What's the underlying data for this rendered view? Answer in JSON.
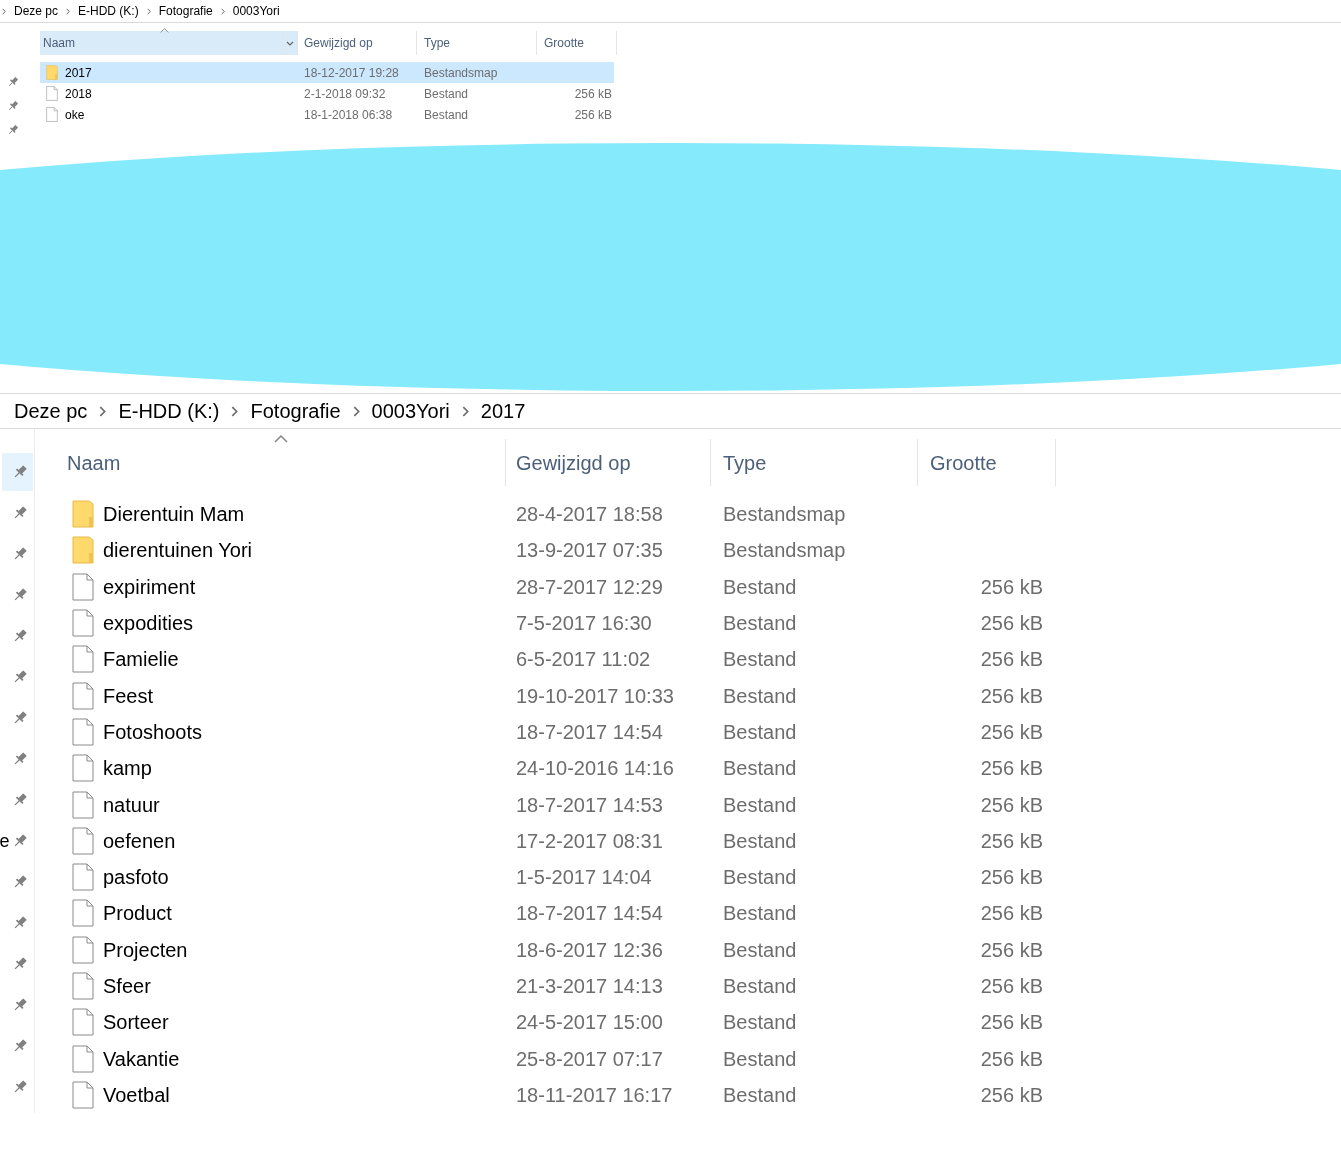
{
  "top_explorer": {
    "breadcrumb": [
      "Deze pc",
      "E-HDD (K:)",
      "Fotografie",
      "0003Yori"
    ],
    "pins": [
      {
        "highlighted": false
      },
      {
        "highlighted": false
      },
      {
        "highlighted": false
      }
    ],
    "columns": [
      "Naam",
      "Gewijzigd op",
      "Type",
      "Grootte"
    ],
    "rows": [
      {
        "kind": "folder",
        "name": "2017",
        "modified": "18-12-2017 19:28",
        "type": "Bestandsmap",
        "selected": true
      },
      {
        "kind": "file",
        "name": "2018",
        "modified": "2-1-2018 09:32",
        "type": "Bestand",
        "size": "256 kB",
        "selected": false
      },
      {
        "kind": "file",
        "name": "oke",
        "modified": "18-1-2018 06:38",
        "type": "Bestand",
        "size": "256 kB",
        "selected": false
      }
    ]
  },
  "bottom_explorer": {
    "breadcrumb": [
      "Deze pc",
      "E-HDD (K:)",
      "Fotografie",
      "0003Yori",
      "2017"
    ],
    "pins": [
      {
        "highlighted": true
      },
      {
        "highlighted": false
      },
      {
        "highlighted": false
      },
      {
        "highlighted": false
      },
      {
        "highlighted": false
      },
      {
        "highlighted": false
      },
      {
        "highlighted": false
      },
      {
        "highlighted": false
      },
      {
        "highlighted": false
      },
      {
        "highlighted": false,
        "label": "e"
      },
      {
        "highlighted": false
      },
      {
        "highlighted": false
      },
      {
        "highlighted": false
      },
      {
        "highlighted": false
      },
      {
        "highlighted": false
      },
      {
        "highlighted": false
      }
    ],
    "columns": [
      "Naam",
      "Gewijzigd op",
      "Type",
      "Grootte"
    ],
    "rows": [
      {
        "kind": "folder",
        "name": "Dierentuin Mam",
        "modified": "28-4-2017 18:58",
        "type": "Bestandsmap",
        "selected": false
      },
      {
        "kind": "folder",
        "name": "dierentuinen Yori",
        "modified": "13-9-2017 07:35",
        "type": "Bestandsmap",
        "selected": false
      },
      {
        "kind": "file",
        "name": "expiriment",
        "modified": "28-7-2017 12:29",
        "type": "Bestand",
        "size": "256 kB",
        "selected": false
      },
      {
        "kind": "file",
        "name": "expodities",
        "modified": "7-5-2017 16:30",
        "type": "Bestand",
        "size": "256 kB",
        "selected": false
      },
      {
        "kind": "file",
        "name": "Famielie",
        "modified": "6-5-2017 11:02",
        "type": "Bestand",
        "size": "256 kB",
        "selected": false
      },
      {
        "kind": "file",
        "name": "Feest",
        "modified": "19-10-2017 10:33",
        "type": "Bestand",
        "size": "256 kB",
        "selected": false
      },
      {
        "kind": "file",
        "name": "Fotoshoots",
        "modified": "18-7-2017 14:54",
        "type": "Bestand",
        "size": "256 kB",
        "selected": false
      },
      {
        "kind": "file",
        "name": "kamp",
        "modified": "24-10-2016 14:16",
        "type": "Bestand",
        "size": "256 kB",
        "selected": false
      },
      {
        "kind": "file",
        "name": "natuur",
        "modified": "18-7-2017 14:53",
        "type": "Bestand",
        "size": "256 kB",
        "selected": false
      },
      {
        "kind": "file",
        "name": "oefenen",
        "modified": "17-2-2017 08:31",
        "type": "Bestand",
        "size": "256 kB",
        "selected": false
      },
      {
        "kind": "file",
        "name": "pasfoto",
        "modified": "1-5-2017 14:04",
        "type": "Bestand",
        "size": "256 kB",
        "selected": false
      },
      {
        "kind": "file",
        "name": "Product",
        "modified": "18-7-2017 14:54",
        "type": "Bestand",
        "size": "256 kB",
        "selected": false
      },
      {
        "kind": "file",
        "name": "Projecten",
        "modified": "18-6-2017 12:36",
        "type": "Bestand",
        "size": "256 kB",
        "selected": false
      },
      {
        "kind": "file",
        "name": "Sfeer",
        "modified": "21-3-2017 14:13",
        "type": "Bestand",
        "size": "256 kB",
        "selected": false
      },
      {
        "kind": "file",
        "name": "Sorteer",
        "modified": "24-5-2017 15:00",
        "type": "Bestand",
        "size": "256 kB",
        "selected": false
      },
      {
        "kind": "file",
        "name": "Vakantie",
        "modified": "25-8-2017 07:17",
        "type": "Bestand",
        "size": "256 kB",
        "selected": false
      },
      {
        "kind": "file",
        "name": "Voetbal",
        "modified": "18-11-2017 16:17",
        "type": "Bestand",
        "size": "256 kB",
        "selected": false
      }
    ]
  }
}
